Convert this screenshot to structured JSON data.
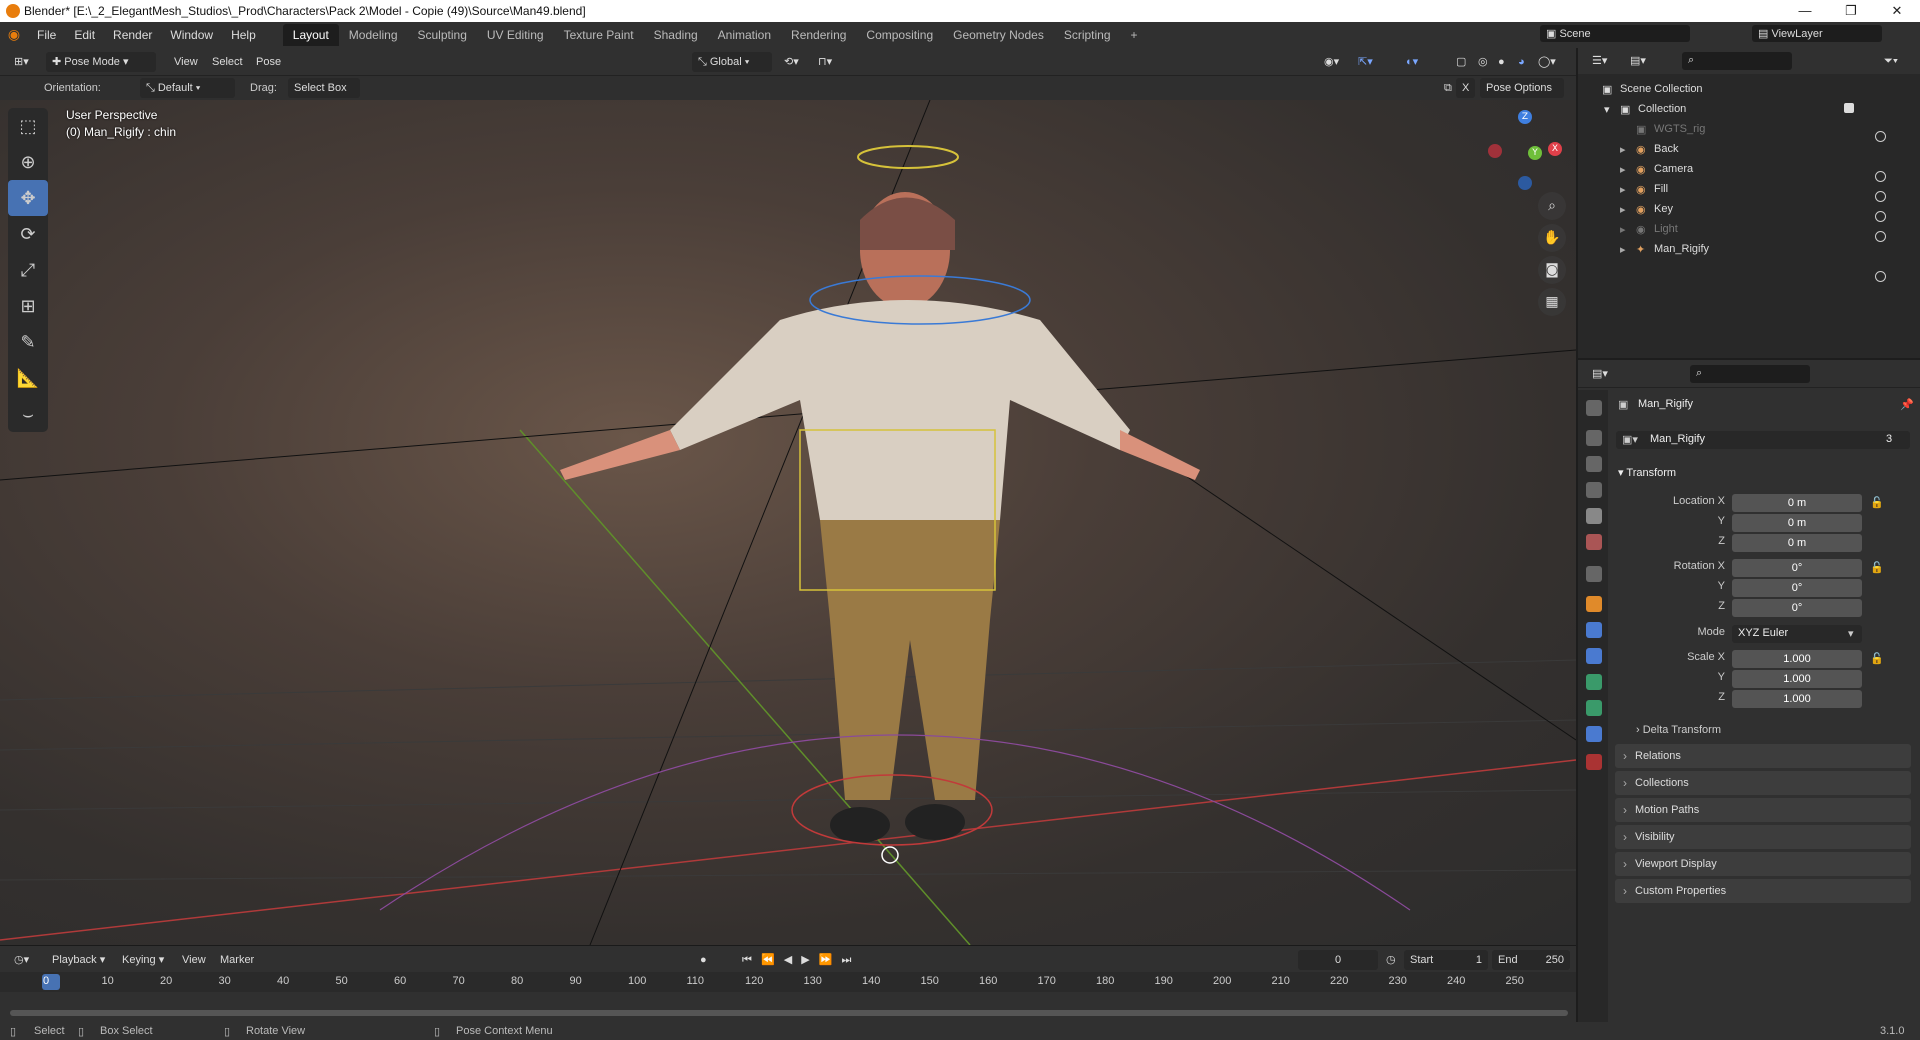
{
  "window": {
    "title": "Blender* [E:\\_2_ElegantMesh_Studios\\_Prod\\Characters\\Pack 2\\Model - Copie (49)\\Source\\Man49.blend]",
    "min": "—",
    "max": "❐",
    "close": "✕"
  },
  "menu": [
    "File",
    "Edit",
    "Render",
    "Window",
    "Help"
  ],
  "workspaces": [
    "Layout",
    "Modeling",
    "Sculpting",
    "UV Editing",
    "Texture Paint",
    "Shading",
    "Animation",
    "Rendering",
    "Compositing",
    "Geometry Nodes",
    "Scripting"
  ],
  "scene": {
    "name": "Scene",
    "viewlayer": "ViewLayer"
  },
  "viewport_header": {
    "mode": "Pose Mode",
    "view": "View",
    "select": "Select",
    "pose": "Pose",
    "transform_orientation": "Global"
  },
  "tool_options": {
    "orientation_label": "Orientation:",
    "orientation_value": "Default",
    "drag_label": "Drag:",
    "drag_value": "Select Box",
    "x_label": "X",
    "pose_options": "Pose Options"
  },
  "viewport": {
    "perspective": "User Perspective",
    "object_info": "(0) Man_Rigify : chin",
    "gizmo": {
      "x": "X",
      "y": "Y",
      "z": "Z"
    }
  },
  "timeline": {
    "playback": "Playback",
    "keying": "Keying",
    "view": "View",
    "marker": "Marker",
    "current_frame": "0",
    "start_label": "Start",
    "start": "1",
    "end_label": "End",
    "end": "250",
    "ticks": [
      "0",
      "10",
      "20",
      "30",
      "40",
      "50",
      "60",
      "70",
      "80",
      "90",
      "100",
      "110",
      "120",
      "130",
      "140",
      "150",
      "160",
      "170",
      "180",
      "190",
      "200",
      "210",
      "220",
      "230",
      "240",
      "250"
    ]
  },
  "status": {
    "select": "Select",
    "box_select": "Box Select",
    "rotate": "Rotate View",
    "context": "Pose Context Menu",
    "version": "3.1.0"
  },
  "outliner": {
    "root": "Scene Collection",
    "collection": "Collection",
    "items": [
      "WGTS_rig",
      "Back",
      "Camera",
      "Fill",
      "Key",
      "Light",
      "Man_Rigify"
    ]
  },
  "properties": {
    "object_name": "Man_Rigify",
    "data_name": "Man_Rigify",
    "users": "3",
    "transform": "Transform",
    "location_x_label": "Location X",
    "y_label": "Y",
    "z_label": "Z",
    "location": [
      "0 m",
      "0 m",
      "0 m"
    ],
    "rotation_x_label": "Rotation X",
    "rotation": [
      "0°",
      "0°",
      "0°"
    ],
    "mode_label": "Mode",
    "mode": "XYZ Euler",
    "scale_x_label": "Scale X",
    "scale": [
      "1.000",
      "1.000",
      "1.000"
    ],
    "delta": "Delta Transform",
    "panels": [
      "Relations",
      "Collections",
      "Motion Paths",
      "Visibility",
      "Viewport Display",
      "Custom Properties"
    ]
  },
  "colors": {
    "accent": "#4772b3",
    "axis_x": "#e0404a",
    "axis_y": "#6fbf3a",
    "axis_z": "#3f7fe0"
  }
}
